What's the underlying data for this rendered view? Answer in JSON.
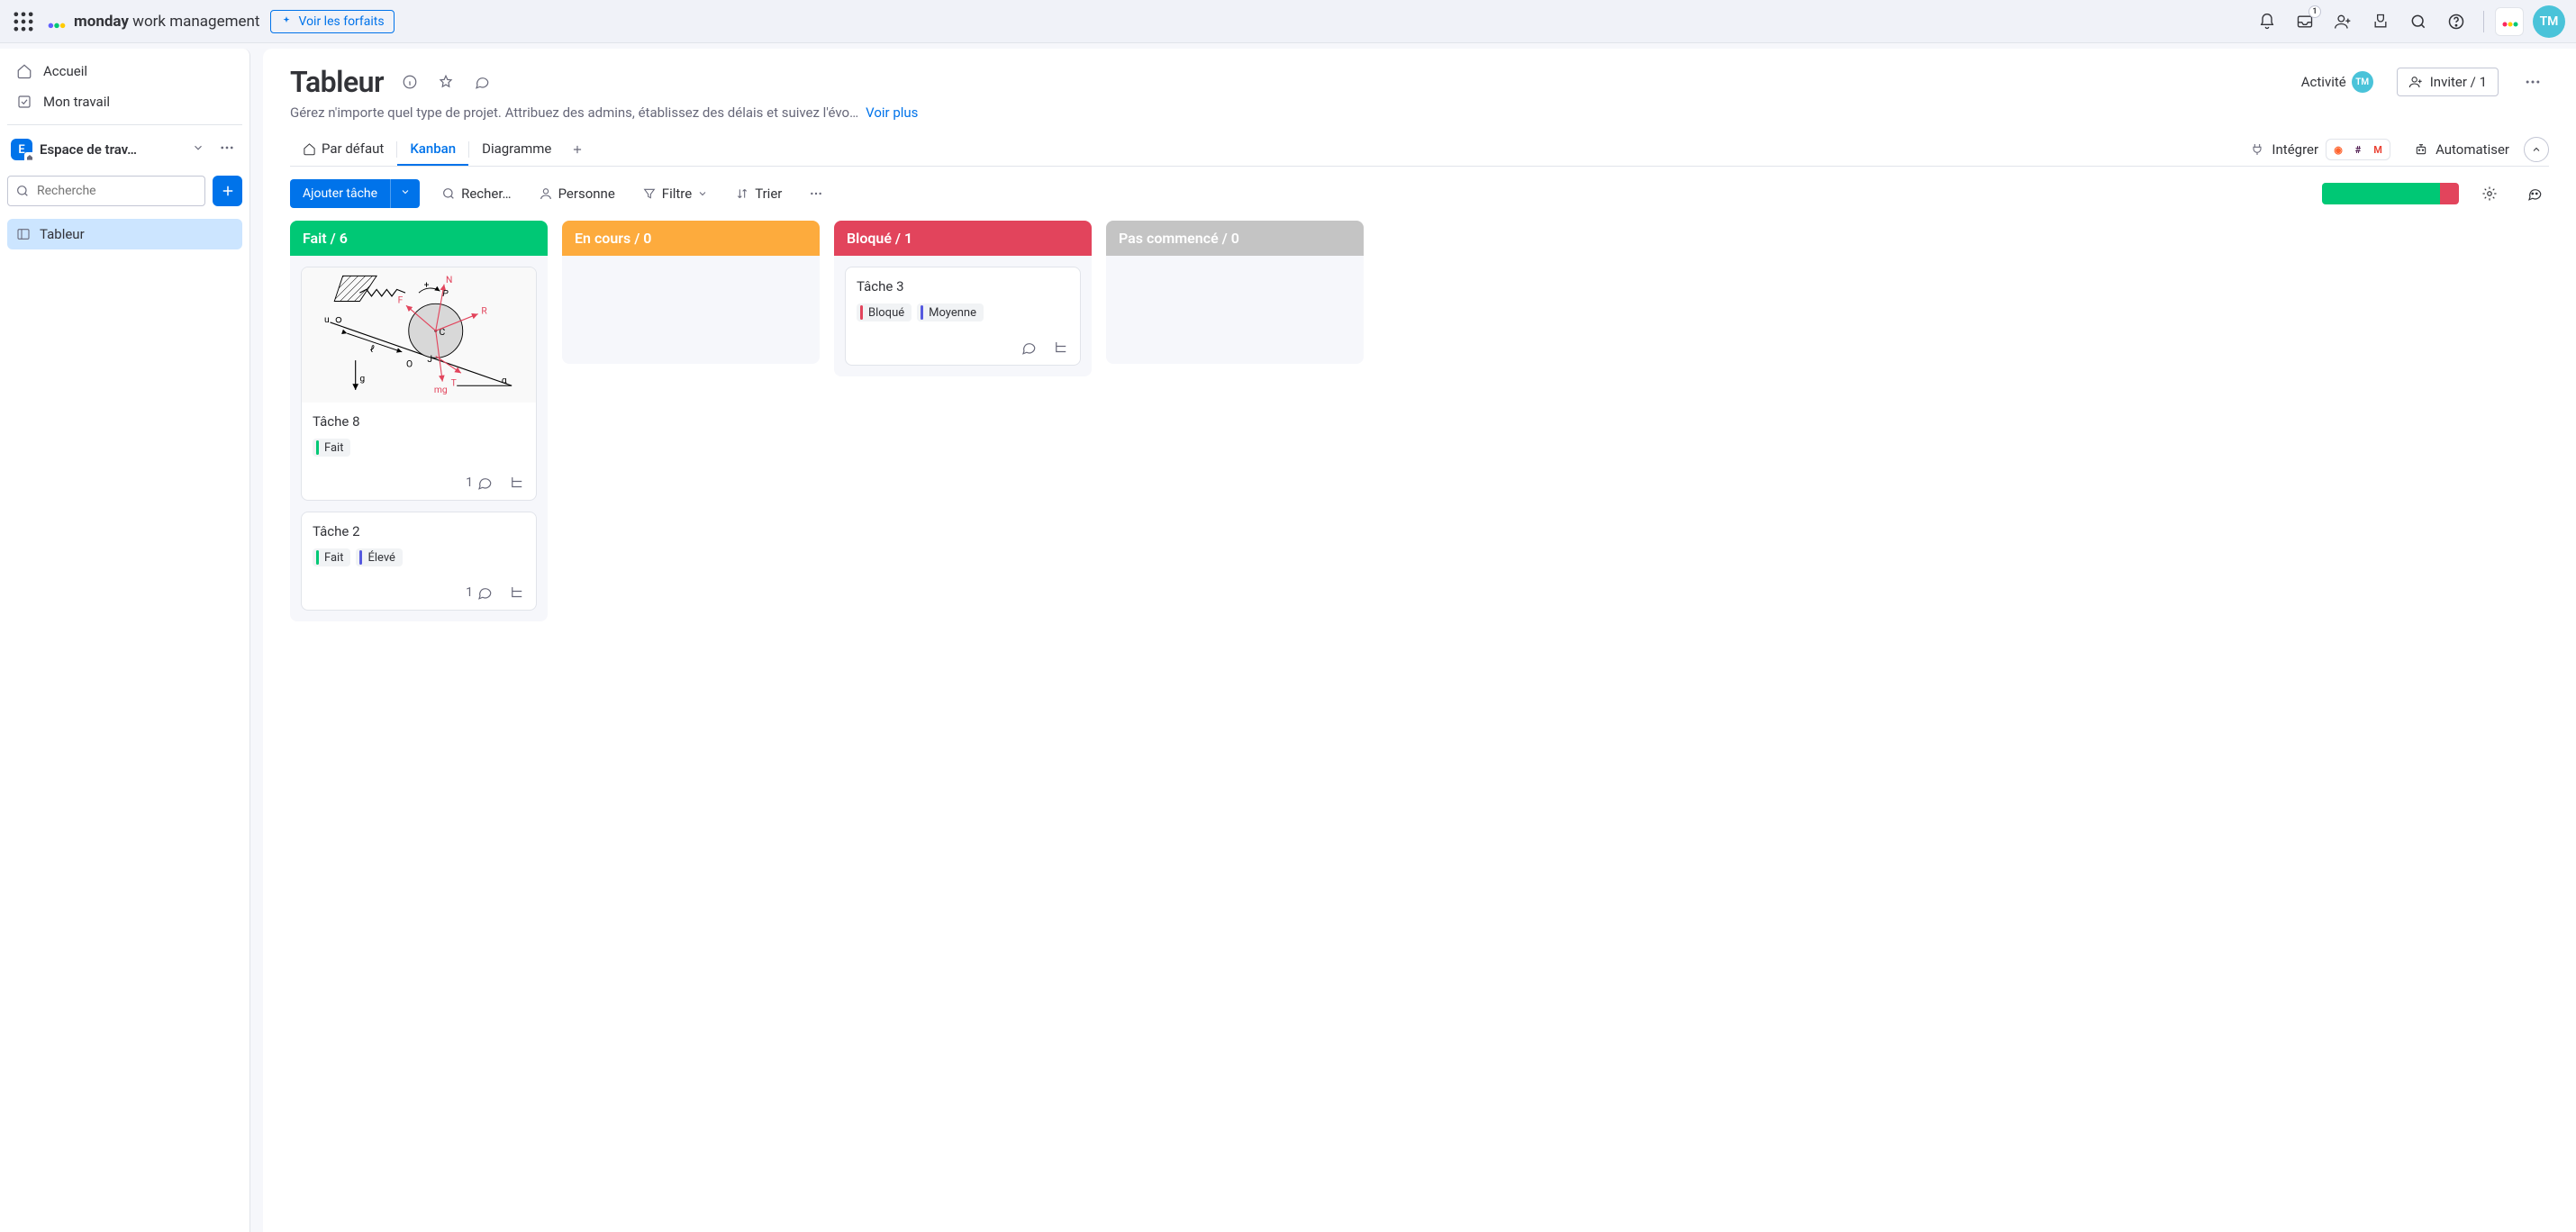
{
  "topbar": {
    "brand_bold": "monday",
    "brand_light": " work management",
    "plans_btn": "Voir les forfaits",
    "inbox_badge": "1",
    "avatar_initials": "TM"
  },
  "sidebar": {
    "home": "Accueil",
    "my_work": "Mon travail",
    "workspace_initial": "E",
    "workspace_name": "Espace de trav…",
    "search_placeholder": "Recherche",
    "board_name": "Tableur"
  },
  "board": {
    "title": "Tableur",
    "subtitle": "Gérez n'importe quel type de projet. Attribuez des admins, établissez des délais et suivez l'évo…",
    "see_more": "Voir plus",
    "activity_label": "Activité",
    "activity_avatar": "TM",
    "invite_label": "Inviter / 1"
  },
  "tabs": {
    "default": "Par défaut",
    "kanban": "Kanban",
    "diagram": "Diagramme",
    "integrate": "Intégrer",
    "automate": "Automatiser"
  },
  "toolbar": {
    "add_task": "Ajouter tâche",
    "search": "Recher…",
    "person": "Personne",
    "filter": "Filtre",
    "sort": "Trier"
  },
  "progress": {
    "green_pct": 86,
    "red_pct": 14,
    "green_color": "#00c875",
    "red_color": "#e2445c"
  },
  "columns": [
    {
      "title": "Fait / 6",
      "color": "#00c875"
    },
    {
      "title": "En cours / 0",
      "color": "#fdab3d"
    },
    {
      "title": "Bloqué / 1",
      "color": "#e2445c"
    },
    {
      "title": "Pas commencé / 0",
      "color": "#c4c4c4"
    }
  ],
  "cards": {
    "c1": {
      "title": "Tâche 8",
      "tags": [
        {
          "label": "Fait",
          "color": "#00c875"
        }
      ],
      "comment_count": "1"
    },
    "c2": {
      "title": "Tâche 2",
      "tags": [
        {
          "label": "Fait",
          "color": "#00c875"
        },
        {
          "label": "Élevé",
          "color": "#5559df"
        }
      ],
      "comment_count": "1"
    },
    "c3": {
      "title": "Tâche 3",
      "tags": [
        {
          "label": "Bloqué",
          "color": "#e2445c"
        },
        {
          "label": "Moyenne",
          "color": "#5559df"
        }
      ]
    }
  },
  "diagram_labels": {
    "N": "N",
    "R": "R",
    "F": "F",
    "P": "P",
    "mg": "mg",
    "T": "T",
    "g": "g",
    "ua": "u",
    "C": "C",
    "J": "J",
    "O": "O",
    "l0": "ℓ",
    "alpha": "α",
    "plus": "+"
  }
}
